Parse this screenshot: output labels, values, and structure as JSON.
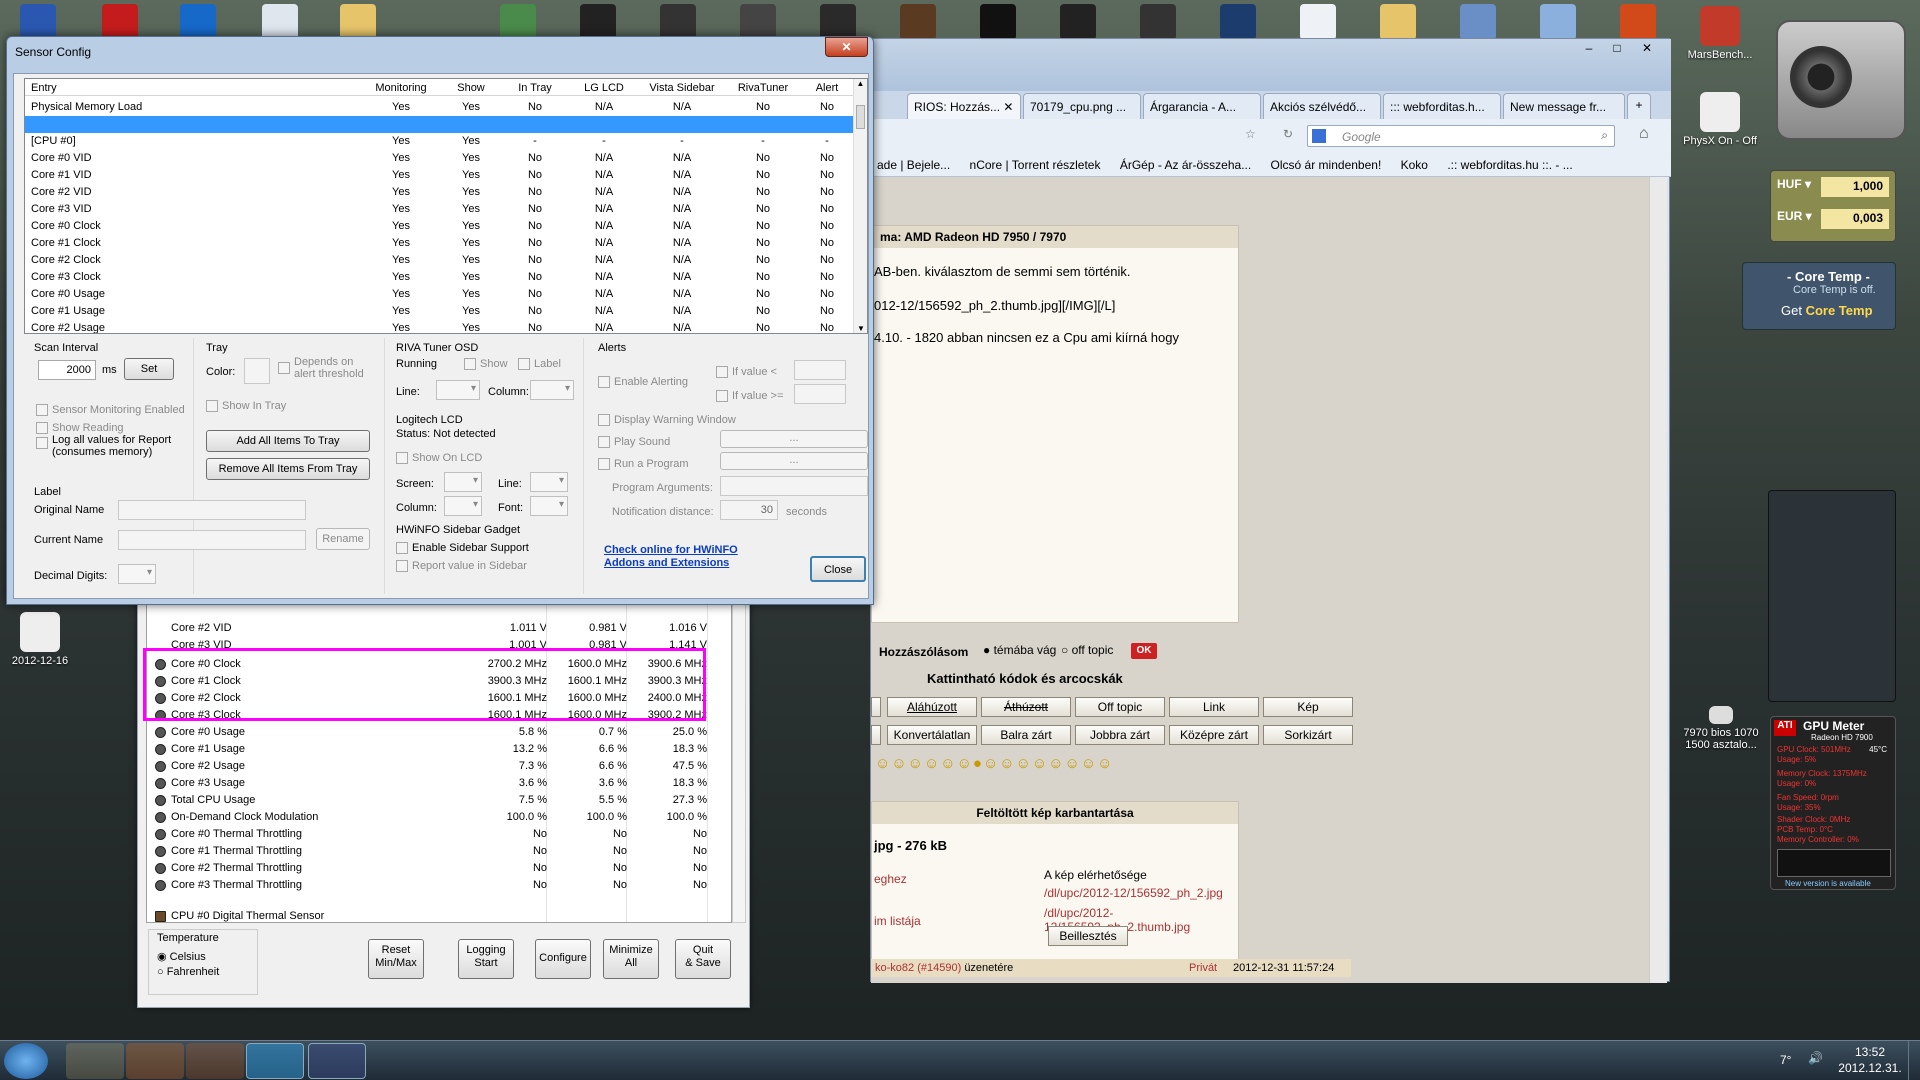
{
  "desktop": {
    "icons": [
      {
        "label": "MarsBench..."
      },
      {
        "label": "PhysX On - Off"
      },
      {
        "label": "2012-12-16"
      },
      {
        "label": "7970 bios 1070 1500 asztalo..."
      }
    ]
  },
  "currency": {
    "rows": [
      {
        "code": "HUF",
        "value": "1,000"
      },
      {
        "code": "EUR",
        "value": "0,003"
      }
    ]
  },
  "coretemp": {
    "title": "- Core Temp -",
    "status": "Core Temp is off.",
    "cta_prefix": "Get ",
    "cta": "Core Temp"
  },
  "gpumeter": {
    "title": "GPU Meter",
    "model": "Radeon HD 7900",
    "lines": [
      "GPU Clock: 501MHz",
      "45°C",
      "Usage: 5%",
      "Memory Clock: 1375MHz",
      "Usage: 0%",
      "Fan Speed: 0rpm",
      "Usage: 35%",
      "Shader Clock: 0MHz",
      "PCB Temp: 0°C",
      "Memory Controller: 0%"
    ],
    "footer": "New version is available"
  },
  "browser": {
    "tabs": [
      "RIOS: Hozzás...",
      "70179_cpu.png ...",
      "Árgarancia - A...",
      "Akciós szélvédő...",
      "::: webforditas.h...",
      "New message fr..."
    ],
    "search_placeholder": "Google",
    "bookmarks": [
      "ade | Bejele...",
      "nCore | Torrent részletek",
      "ÁrGép - Az ár-összeha...",
      "Olcsó ár mindenben!",
      "Koko",
      ".:: webforditas.hu ::. - ..."
    ],
    "topic_title": "ma: AMD Radeon HD 7950 / 7970",
    "post_lines": [
      "AB-ben. kiválasztom de semmi sem történik.",
      "012-12/156592_ph_2.thumb.jpg][/IMG][/L]",
      "4.10. - 1820  abban nincsen ez a Cpu ami kiírná hogy"
    ],
    "reply_label": "Hozzászólásom",
    "radio1": "témába vág",
    "radio2": "off topic",
    "off_badge": "OK",
    "codes_header": "Kattintható kódok és arcocskák",
    "format_row1": [
      "Aláhúzott",
      "Áthúzott",
      "Off topic",
      "Link",
      "Kép"
    ],
    "format_row2": [
      "Konvertálatlan",
      "Balra zárt",
      "Jobbra zárt",
      "Középre zárt",
      "Sorkizárt"
    ],
    "upload_header": "Feltöltött kép karbantartása",
    "upload_file": "jpg - 276 kB",
    "upload_left1": "eghez",
    "upload_left2": "im listája",
    "avail_label": "A kép elérhetősége",
    "link1": "/dl/upc/2012-12/156592_ph_2.jpg",
    "link2": "/dl/upc/2012-12/156592_ph_2.thumb.jpg",
    "insert_btn": "Beillesztés",
    "footer_user": "ko-ko82",
    "footer_num": "(#14590)",
    "footer_msg": "üzenetére",
    "footer_priv": "Privát",
    "footer_time": "2012-12-31 11:57:24"
  },
  "sensors": {
    "partial_top": [
      "Core #2 VID",
      "1.011 V",
      "0.981 V",
      "1.016 V",
      "Core #3 VID",
      "1.001 V",
      "0.981 V",
      "1.141 V"
    ],
    "rows": [
      [
        "Core #0 Clock",
        "2700.2 MHz",
        "1600.0 MHz",
        "3900.6 MHz"
      ],
      [
        "Core #1 Clock",
        "3900.3 MHz",
        "1600.1 MHz",
        "3900.3 MHz"
      ],
      [
        "Core #2 Clock",
        "1600.1 MHz",
        "1600.0 MHz",
        "2400.0 MHz"
      ],
      [
        "Core #3 Clock",
        "1600.1 MHz",
        "1600.0 MHz",
        "3900.2 MHz"
      ],
      [
        "Core #0 Usage",
        "5.8 %",
        "0.7 %",
        "25.0 %"
      ],
      [
        "Core #1 Usage",
        "13.2 %",
        "6.6 %",
        "18.3 %"
      ],
      [
        "Core #2 Usage",
        "7.3 %",
        "6.6 %",
        "47.5 %"
      ],
      [
        "Core #3 Usage",
        "3.6 %",
        "3.6 %",
        "18.3 %"
      ],
      [
        "Total CPU Usage",
        "7.5 %",
        "5.5 %",
        "27.3 %"
      ],
      [
        "On-Demand Clock Modulation",
        "100.0 %",
        "100.0 %",
        "100.0 %"
      ],
      [
        "Core #0 Thermal Throttling",
        "No",
        "No",
        "No"
      ],
      [
        "Core #1 Thermal Throttling",
        "No",
        "No",
        "No"
      ],
      [
        "Core #2 Thermal Throttling",
        "No",
        "No",
        "No"
      ],
      [
        "Core #3 Thermal Throttling",
        "No",
        "No",
        "No"
      ]
    ],
    "section": "CPU #0 Digital Thermal Sensor",
    "temp_label": "Temperature",
    "celsius": "Celsius",
    "fahrenheit": "Fahrenheit",
    "buttons": [
      "Reset\nMin/Max",
      "Logging\nStart",
      "Configure",
      "Minimize\nAll",
      "Quit\n& Save"
    ]
  },
  "config": {
    "title": "Sensor Config",
    "columns": [
      "Entry",
      "Monitoring",
      "Show",
      "In Tray",
      "LG LCD",
      "Vista Sidebar",
      "RivaTuner",
      "Alert"
    ],
    "rows": [
      [
        "Physical Memory Load",
        "Yes",
        "Yes",
        "No",
        "N/A",
        "N/A",
        "No",
        "No"
      ],
      [
        "",
        "",
        "",
        "",
        "",
        "",
        "",
        ""
      ],
      [
        "[CPU #0]",
        "Yes",
        "Yes",
        "-",
        "-",
        "-",
        "-",
        "-"
      ],
      [
        "Core #0 VID",
        "Yes",
        "Yes",
        "No",
        "N/A",
        "N/A",
        "No",
        "No"
      ],
      [
        "Core #1 VID",
        "Yes",
        "Yes",
        "No",
        "N/A",
        "N/A",
        "No",
        "No"
      ],
      [
        "Core #2 VID",
        "Yes",
        "Yes",
        "No",
        "N/A",
        "N/A",
        "No",
        "No"
      ],
      [
        "Core #3 VID",
        "Yes",
        "Yes",
        "No",
        "N/A",
        "N/A",
        "No",
        "No"
      ],
      [
        "Core #0 Clock",
        "Yes",
        "Yes",
        "No",
        "N/A",
        "N/A",
        "No",
        "No"
      ],
      [
        "Core #1 Clock",
        "Yes",
        "Yes",
        "No",
        "N/A",
        "N/A",
        "No",
        "No"
      ],
      [
        "Core #2 Clock",
        "Yes",
        "Yes",
        "No",
        "N/A",
        "N/A",
        "No",
        "No"
      ],
      [
        "Core #3 Clock",
        "Yes",
        "Yes",
        "No",
        "N/A",
        "N/A",
        "No",
        "No"
      ],
      [
        "Core #0 Usage",
        "Yes",
        "Yes",
        "No",
        "N/A",
        "N/A",
        "No",
        "No"
      ],
      [
        "Core #1 Usage",
        "Yes",
        "Yes",
        "No",
        "N/A",
        "N/A",
        "No",
        "No"
      ],
      [
        "Core #2 Usage",
        "Yes",
        "Yes",
        "No",
        "N/A",
        "N/A",
        "No",
        "No"
      ]
    ],
    "scan_label": "Scan Interval",
    "scan_value": "2000",
    "scan_unit": "ms",
    "set_btn": "Set",
    "sensor_monitoring": "Sensor Monitoring Enabled",
    "show_reading": "Show Reading",
    "log_all": "Log all values for Report",
    "log_all2": "(consumes memory)",
    "tray_label": "Tray",
    "color_label": "Color:",
    "depends": "Depends on",
    "depends2": "alert threshold",
    "show_in_tray": "Show In Tray",
    "add_all": "Add All Items To Tray",
    "remove_all": "Remove All Items From Tray",
    "label_group": "Label",
    "original_name": "Original Name",
    "current_name": "Current Name",
    "rename": "Rename",
    "decimal": "Decimal Digits:",
    "riva_label": "RIVA Tuner OSD",
    "running": "Running",
    "show": "Show",
    "label": "Label",
    "line": "Line:",
    "column": "Column:",
    "logitech": "Logitech LCD",
    "status": "Status: Not detected",
    "show_on_lcd": "Show On LCD",
    "screen": "Screen:",
    "font": "Font:",
    "gadget": "HWiNFO Sidebar Gadget",
    "enable_sidebar": "Enable Sidebar Support",
    "report_sidebar": "Report value in Sidebar",
    "alerts": "Alerts",
    "enable_alerting": "Enable Alerting",
    "if_value_lt": "If value  <",
    "if_value_ge": "If value >=",
    "display_warning": "Display Warning Window",
    "play_sound": "Play Sound",
    "run_program": "Run a Program",
    "ellipsis": "...",
    "program_args": "Program Arguments:",
    "notif_dist": "Notification distance:",
    "notif_value": "30",
    "seconds": "seconds",
    "check_online": "Check online for HWiNFO",
    "check_online2": "Addons and Extensions",
    "close": "Close"
  },
  "tray": {
    "time": "13:52",
    "date": "2012.12.31.",
    "temp": "7°"
  }
}
